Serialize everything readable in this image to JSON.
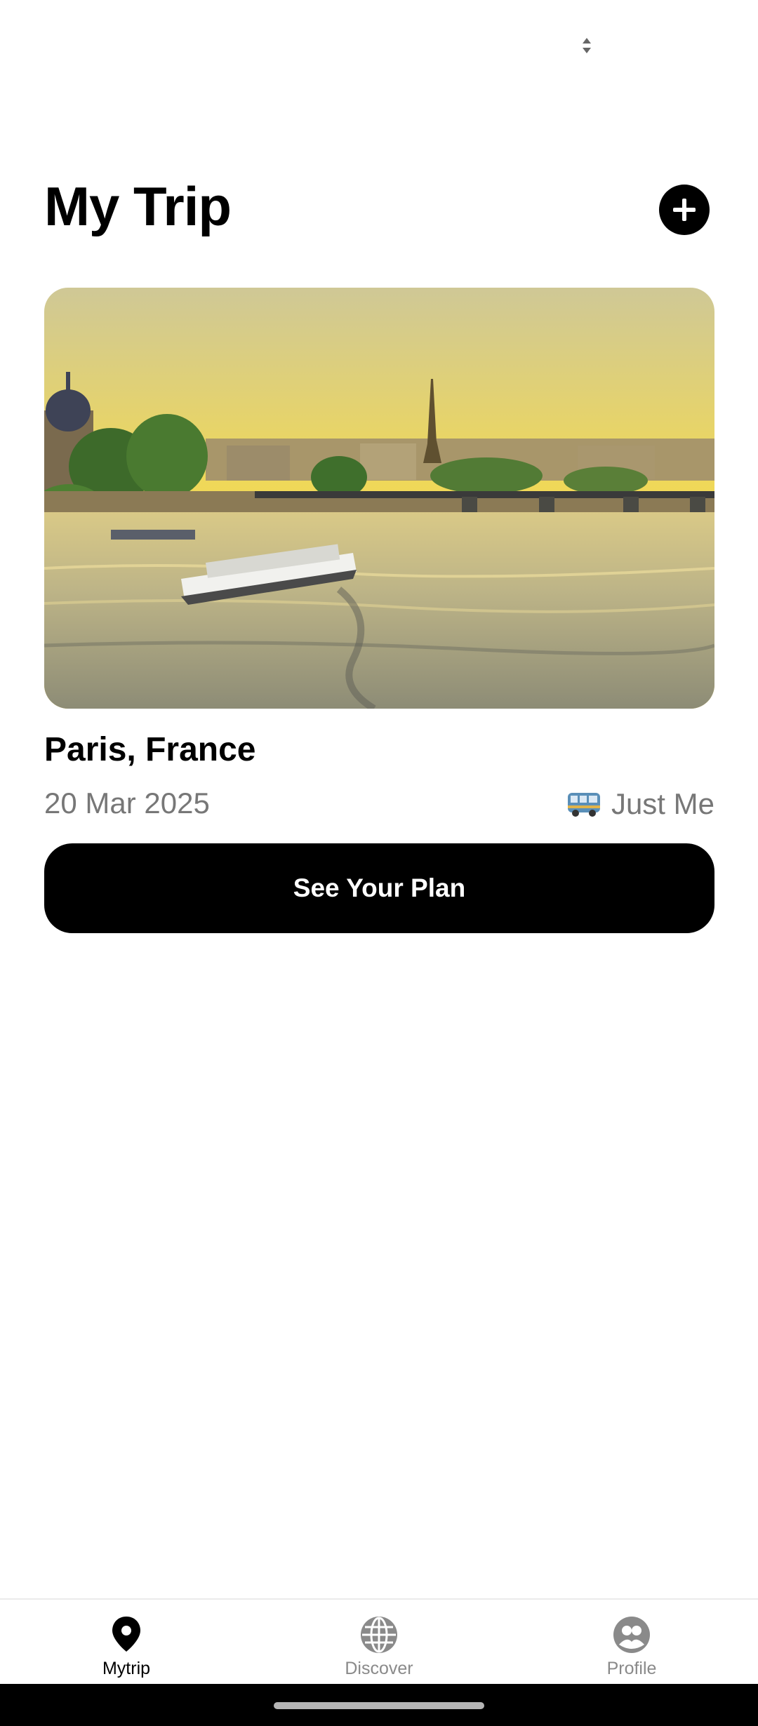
{
  "header": {
    "title": "My Trip",
    "add_icon": "plus-icon"
  },
  "trip": {
    "image_description": "Seine river at sunset with Eiffel Tower and tour boat",
    "location": "Paris, France",
    "date": "20 Mar 2025",
    "companions_icon": "bus-icon",
    "companions": "Just Me",
    "plan_button": "See Your Plan"
  },
  "bottom_nav": {
    "items": [
      {
        "label": "Mytrip",
        "icon": "location-pin-icon",
        "active": true
      },
      {
        "label": "Discover",
        "icon": "globe-icon",
        "active": false
      },
      {
        "label": "Profile",
        "icon": "profile-icon",
        "active": false
      }
    ]
  },
  "colors": {
    "primary": "#000000",
    "muted_text": "#777777",
    "inactive_nav": "#8a8a8a",
    "background": "#ffffff"
  }
}
